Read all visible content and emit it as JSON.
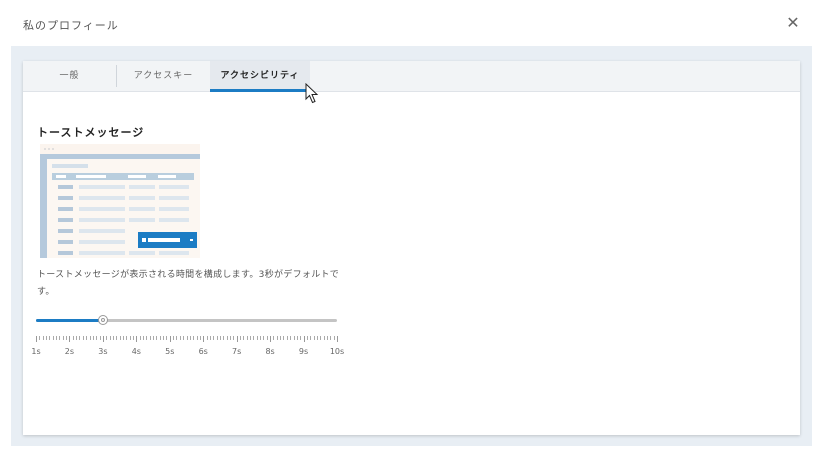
{
  "dialog": {
    "title": "私のプロフィール",
    "close_label": "✕"
  },
  "tabs": [
    {
      "label": "一般",
      "active": false
    },
    {
      "label": "アクセスキー",
      "active": false
    },
    {
      "label": "アクセシビリティ",
      "active": true
    }
  ],
  "toast": {
    "title": "トーストメッセージ",
    "description": "トーストメッセージが表示される時間を構成します。3秒がデフォルトです。",
    "slider": {
      "min": 1,
      "max": 10,
      "value": 3,
      "labels": [
        "1s",
        "2s",
        "3s",
        "4s",
        "5s",
        "6s",
        "7s",
        "8s",
        "9s",
        "10s"
      ]
    }
  },
  "colors": {
    "accent": "#1c7cc4",
    "body_background": "#e8eef4",
    "track": "#c4c4c4"
  },
  "icons": {
    "close": "close-icon",
    "cursor": "mouse-pointer-icon"
  }
}
